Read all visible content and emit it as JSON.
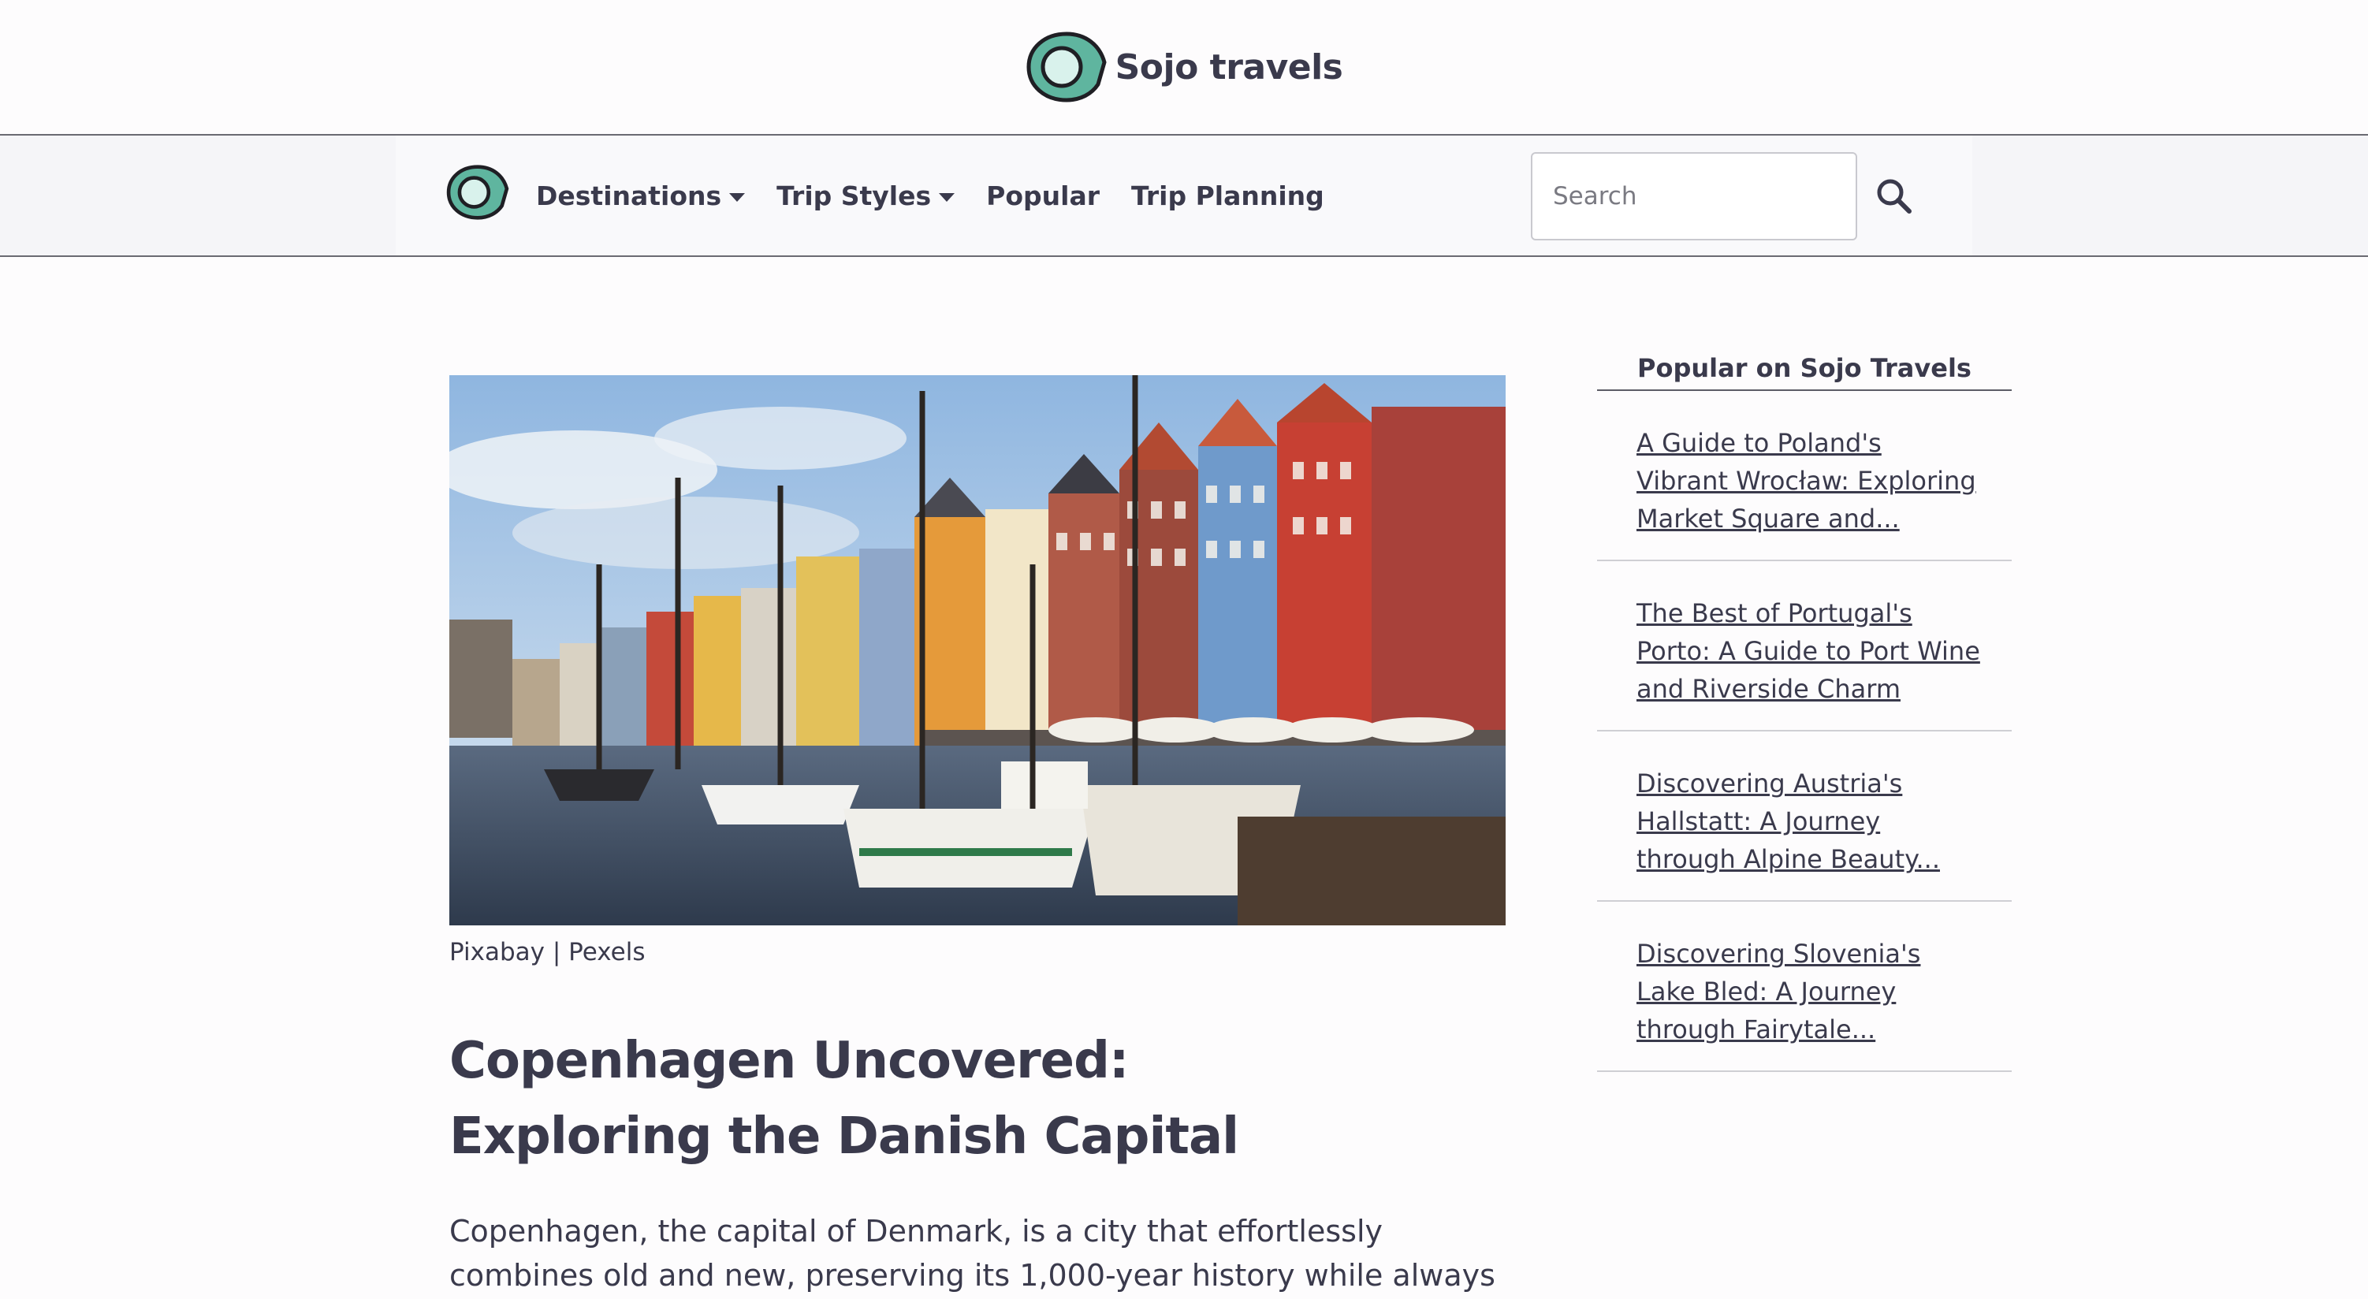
{
  "brand": {
    "name": "Sojo travels",
    "logo_icon": "sojo-logo-icon",
    "accent": "#5fb59f"
  },
  "nav": {
    "items": [
      {
        "label": "Destinations",
        "dropdown": true
      },
      {
        "label": "Trip Styles",
        "dropdown": true
      },
      {
        "label": "Popular",
        "dropdown": false
      },
      {
        "label": "Trip Planning",
        "dropdown": false
      }
    ],
    "search_placeholder": "Search",
    "search_icon": "search-icon"
  },
  "article": {
    "image_alt": "Colorful harbor houses and sailboats along a canal",
    "image_credit": "Pixabay | Pexels",
    "title_line1": "Copenhagen Uncovered:",
    "title_line2": "Exploring the Danish Capital",
    "lead_line1": "Copenhagen, the capital of Denmark, is a city that effortlessly",
    "lead_line2": "combines old and new, preserving its 1,000-year history while always"
  },
  "sidebar": {
    "heading": "Popular on Sojo Travels",
    "items": [
      {
        "lines": [
          "A Guide to Poland's",
          "Vibrant Wrocław: Exploring",
          "Market Square and..."
        ]
      },
      {
        "lines": [
          "The Best of Portugal's",
          "Porto: A Guide to Port Wine",
          "and Riverside Charm"
        ]
      },
      {
        "lines": [
          "Discovering Austria's",
          "Hallstatt: A Journey",
          "through Alpine Beauty..."
        ]
      },
      {
        "lines": [
          "Discovering Slovenia's",
          "Lake Bled: A Journey",
          "through Fairytale..."
        ]
      }
    ]
  }
}
